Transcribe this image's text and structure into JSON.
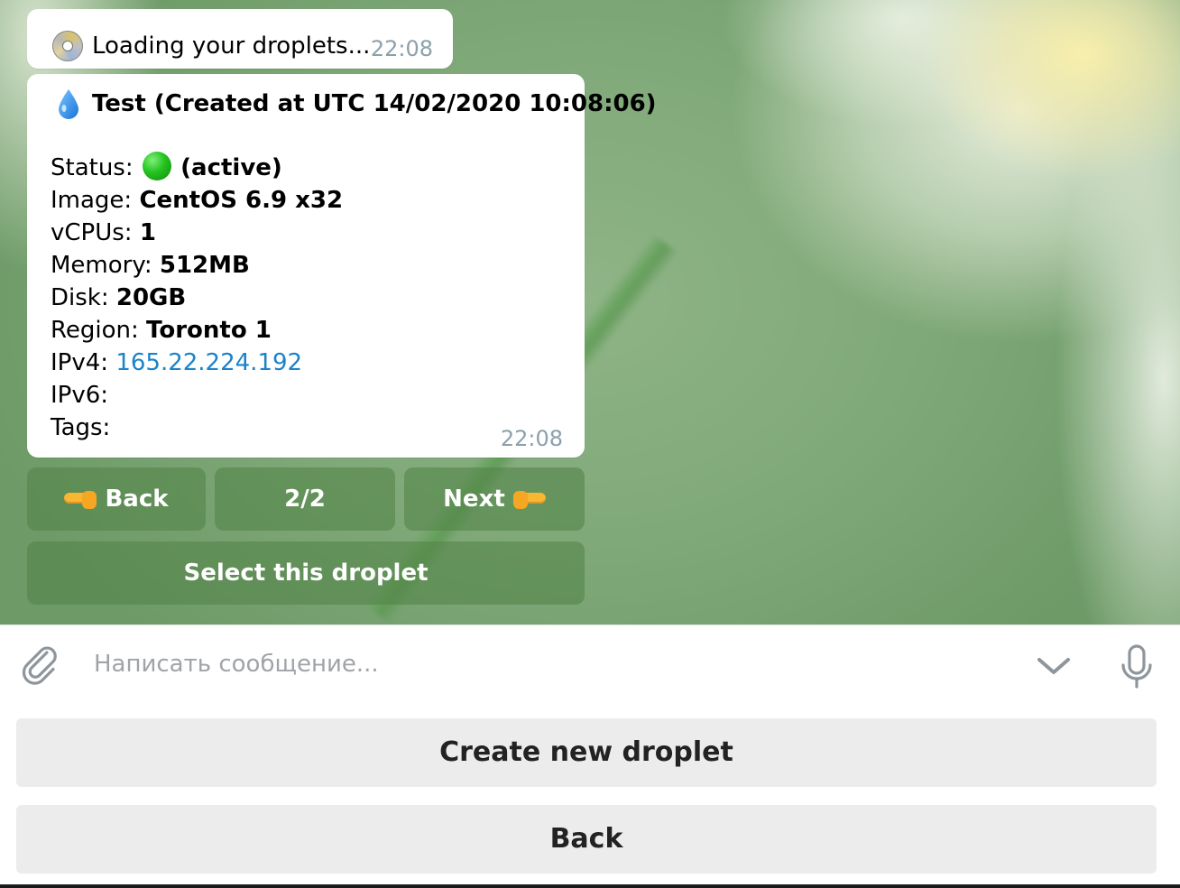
{
  "messages": {
    "loading": {
      "text": "Loading your droplets...",
      "time": "22:08",
      "icon": "disc-icon"
    },
    "droplet_info": {
      "title": "Test (Created at UTC 14/02/2020 10:08:06)",
      "icon": "droplet-icon",
      "status_label": "Status:",
      "status_value": "(active)",
      "status_color": "#24c21e",
      "image_label": "Image:",
      "image_value": "CentOS 6.9 x32",
      "vcpus_label": "vCPUs:",
      "vcpus_value": "1",
      "memory_label": "Memory:",
      "memory_value": "512MB",
      "disk_label": "Disk:",
      "disk_value": "20GB",
      "region_label": "Region:",
      "region_value": "Toronto 1",
      "ipv4_label": "IPv4:",
      "ipv4_value": "165.22.224.192",
      "ipv6_label": "IPv6:",
      "tags_label": "Tags:",
      "time": "22:08"
    }
  },
  "inline_keyboard": {
    "back_label": "Back",
    "page_label": "2/2",
    "next_label": "Next",
    "select_label": "Select this droplet"
  },
  "input": {
    "placeholder": "Написать сообщение..."
  },
  "reply_keyboard": {
    "create_label": "Create new droplet",
    "back_label": "Back"
  },
  "colors": {
    "link": "#1a83c9",
    "time": "#8ca0ab",
    "inline_button_bg": "rgba(80,130,70,0.55)",
    "reply_button_bg": "#ececec"
  }
}
